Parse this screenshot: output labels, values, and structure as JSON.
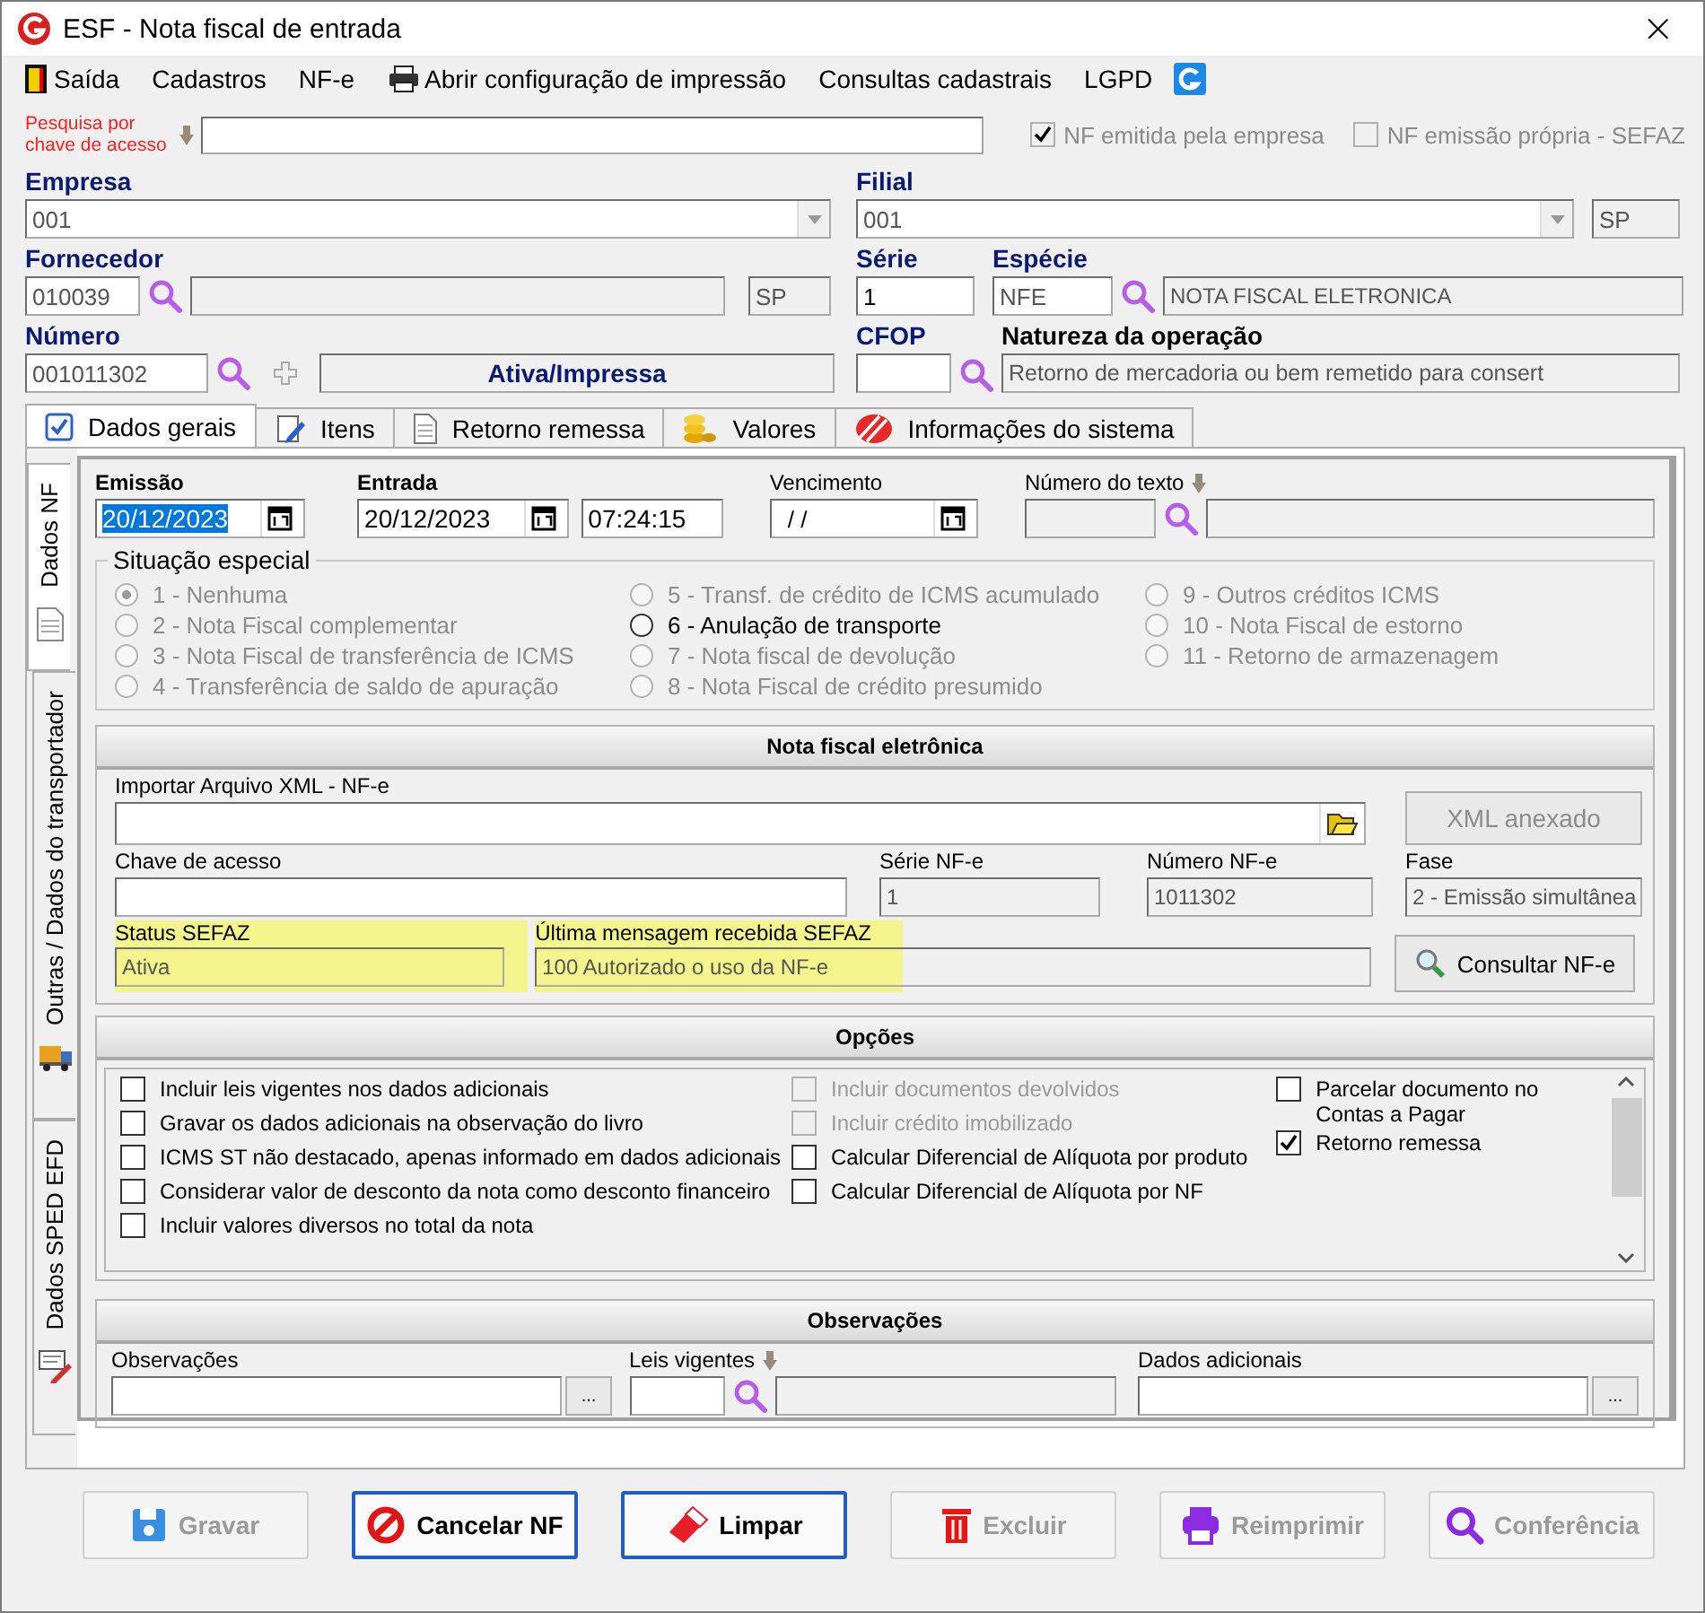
{
  "window": {
    "title": "ESF - Nota fiscal de entrada",
    "close": "×"
  },
  "menu": [
    "Saída",
    "Cadastros",
    "NF-e",
    "Abrir configuração de impressão",
    "Consultas cadastrais",
    "LGPD"
  ],
  "search": {
    "label": "Pesquisa por chave de acesso"
  },
  "flags": [
    {
      "label": "NF emitida pela empresa",
      "checked": true,
      "disabled": true
    },
    {
      "label": "NF emissão própria - SEFAZ",
      "checked": false,
      "disabled": true
    }
  ],
  "header": {
    "empresa": {
      "label": "Empresa",
      "value": "001"
    },
    "filial": {
      "label": "Filial",
      "value": "001",
      "uf": "SP"
    },
    "fornecedor": {
      "label": "Fornecedor",
      "code": "010039",
      "uf": "SP"
    },
    "serie": {
      "label": "Série",
      "value": "1"
    },
    "especie": {
      "label": "Espécie",
      "code": "NFE",
      "description": "NOTA FISCAL ELETRONICA"
    },
    "numero": {
      "label": "Número",
      "value": "001011302",
      "status": "Ativa/Impressa"
    },
    "cfop": {
      "label": "CFOP"
    },
    "natureza": {
      "label": "Natureza da operação",
      "value": "Retorno de mercadoria ou bem remetido para consert"
    }
  },
  "tabs": [
    {
      "label": "Dados gerais",
      "selected": true
    },
    {
      "label": "Itens",
      "selected": false
    },
    {
      "label": "Retorno remessa",
      "selected": false
    },
    {
      "label": "Valores",
      "selected": false
    },
    {
      "label": "Informações do sistema",
      "selected": false
    }
  ],
  "side_tabs": [
    {
      "label": "Dados NF",
      "selected": true
    },
    {
      "label": "Outras / Dados do transportador",
      "selected": false
    },
    {
      "label": "Dados SPED EFD",
      "selected": false
    }
  ],
  "dates": {
    "emissao": {
      "label": "Emissão",
      "value": "20/12/2023",
      "highlighted": true
    },
    "entrada": {
      "label": "Entrada",
      "value": "20/12/2023",
      "time": "07:24:15"
    },
    "vencimento": {
      "label": "Vencimento",
      "value": "/ /"
    },
    "numero_texto": {
      "label": "Número do texto"
    }
  },
  "situacao_especial": {
    "title": "Situação especial",
    "options": [
      {
        "label": "1 - Nenhuma",
        "selected": true,
        "disabled": true
      },
      {
        "label": "2 - Nota Fiscal complementar",
        "selected": false,
        "disabled": true
      },
      {
        "label": "3 - Nota Fiscal de transferência de ICMS",
        "selected": false,
        "disabled": true
      },
      {
        "label": "4 - Transferência de saldo de apuração",
        "selected": false,
        "disabled": true
      },
      {
        "label": "5 - Transf. de crédito de ICMS acumulado",
        "selected": false,
        "disabled": true
      },
      {
        "label": "6 - Anulação de transporte",
        "selected": false,
        "disabled": false
      },
      {
        "label": "7 - Nota fiscal de devolução",
        "selected": false,
        "disabled": true
      },
      {
        "label": "8 - Nota Fiscal de crédito presumido",
        "selected": false,
        "disabled": true
      },
      {
        "label": "9 - Outros créditos ICMS",
        "selected": false,
        "disabled": true
      },
      {
        "label": "10 - Nota Fiscal de estorno",
        "selected": false,
        "disabled": true
      },
      {
        "label": "11 - Retorno de armazenagem",
        "selected": false,
        "disabled": true
      }
    ]
  },
  "nfe": {
    "title": "Nota fiscal eletrônica",
    "import_label": "Importar Arquivo XML - NF-e",
    "xml_button": {
      "label": "XML anexado",
      "disabled": true
    },
    "chave_label": "Chave de acesso",
    "serie": {
      "label": "Série NF-e",
      "value": "1"
    },
    "numero": {
      "label": "Número NF-e",
      "value": "1011302"
    },
    "fase": {
      "label": "Fase",
      "value": "2 - Emissão simultânea"
    },
    "status": {
      "label": "Status SEFAZ",
      "value": "Ativa"
    },
    "mensagem": {
      "label": "Última mensagem recebida SEFAZ",
      "value": "100 Autorizado o uso da NF-e"
    },
    "consultar_button": "Consultar NF-e"
  },
  "opcoes": {
    "title": "Opções",
    "columns": [
      [
        {
          "label": "Incluir leis vigentes nos dados adicionais",
          "checked": false,
          "disabled": false
        },
        {
          "label": "Gravar os dados adicionais na observação do livro",
          "checked": false,
          "disabled": false
        },
        {
          "label": "ICMS ST  não destacado, apenas informado em dados adicionais",
          "checked": false,
          "disabled": false
        },
        {
          "label": "Considerar valor de desconto da nota como desconto financeiro",
          "checked": false,
          "disabled": false
        },
        {
          "label": "Incluir valores diversos no total da nota",
          "checked": false,
          "disabled": false
        }
      ],
      [
        {
          "label": "Incluir documentos devolvidos",
          "checked": false,
          "disabled": true
        },
        {
          "label": "Incluir crédito imobilizado",
          "checked": false,
          "disabled": true
        },
        {
          "label": "Calcular Diferencial de Alíquota por produto",
          "checked": false,
          "disabled": false
        },
        {
          "label": "Calcular Diferencial de Alíquota por NF",
          "checked": false,
          "disabled": false
        }
      ],
      [
        {
          "label": "Parcelar documento no Contas a Pagar",
          "checked": false,
          "disabled": false
        },
        {
          "label": "Retorno remessa",
          "checked": true,
          "disabled": false
        }
      ]
    ]
  },
  "observacoes": {
    "title": "Observações",
    "observacoes_label": "Observações",
    "leis_label": "Leis vigentes",
    "dados_label": "Dados adicionais",
    "more_button": "..."
  },
  "buttons": [
    {
      "label": "Gravar",
      "disabled": true
    },
    {
      "label": "Cancelar NF",
      "disabled": false
    },
    {
      "label": "Limpar",
      "disabled": false
    },
    {
      "label": "Excluir",
      "disabled": true
    },
    {
      "label": "Reimprimir",
      "disabled": true
    },
    {
      "label": "Conferência",
      "disabled": true
    }
  ]
}
